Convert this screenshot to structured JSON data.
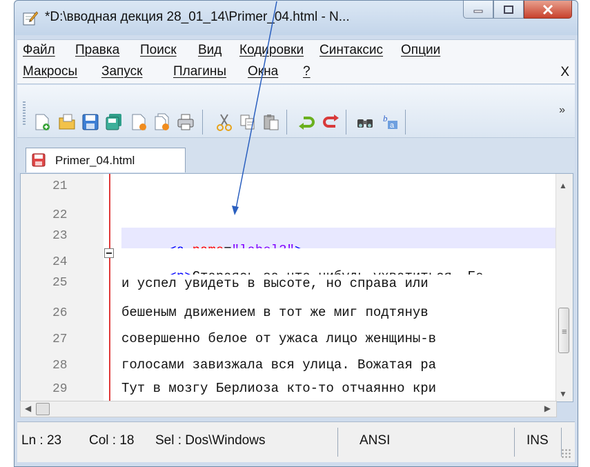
{
  "window": {
    "title": "*D:\\вводная декция 28_01_14\\Primer_04.html - N...",
    "icon": "notepad-plus-icon"
  },
  "menu": {
    "row1": [
      "Файл",
      "Правка",
      "Поиск",
      "Вид",
      "Кодировки",
      "Синтаксис",
      "Опции"
    ],
    "row2": [
      "Макросы",
      "Запуск",
      "Плагины",
      "Окна",
      "?"
    ],
    "close_label": "X"
  },
  "toolbar": {
    "buttons": [
      "new-file-icon",
      "open-file-icon",
      "save-icon",
      "save-all-icon",
      "close-icon",
      "close-all-icon",
      "print-icon",
      "cut-icon",
      "copy-icon",
      "paste-icon",
      "undo-icon",
      "redo-icon",
      "find-icon",
      "replace-icon"
    ],
    "more_label": "»"
  },
  "tab": {
    "label": "Primer_04.html"
  },
  "editor": {
    "current_line": 23,
    "lines": [
      {
        "number": "21",
        "text": ""
      },
      {
        "number": "22",
        "text": ""
      },
      {
        "number": "23",
        "tag_open": "<a ",
        "attr": "name",
        "equals": "=",
        "value": "\"label3\"",
        "tag_close": ">"
      },
      {
        "number": "24",
        "tag_open": "<p>",
        "text": "Стараясь за что-нибудь ухватиться, Бе"
      },
      {
        "number": "25",
        "text": "и успел увидеть в высоте, но справа или"
      },
      {
        "number": "26",
        "text": "бешеным движением в тот же миг подтянув"
      },
      {
        "number": "27",
        "text": "совершенно белое от ужаса лицо женщины-в"
      },
      {
        "number": "28",
        "text": "голосами завизжала вся улица. Вожатая ра"
      },
      {
        "number": "29",
        "text": "Тут в мозгу Берлиоза кто-то отчаянно кри"
      }
    ]
  },
  "status": {
    "ln": "Ln : 23",
    "col": "Col : 18",
    "sel": "Sel : Dos\\Windows",
    "encoding": "ANSI",
    "mode": "INS"
  },
  "colors": {
    "tag": "#0000ff",
    "attr": "#ff0000",
    "value": "#8000ff",
    "current_line_bg": "#e8e8ff",
    "fold_line": "#e03a3a",
    "annotation_arrow": "#2a5fbf"
  }
}
